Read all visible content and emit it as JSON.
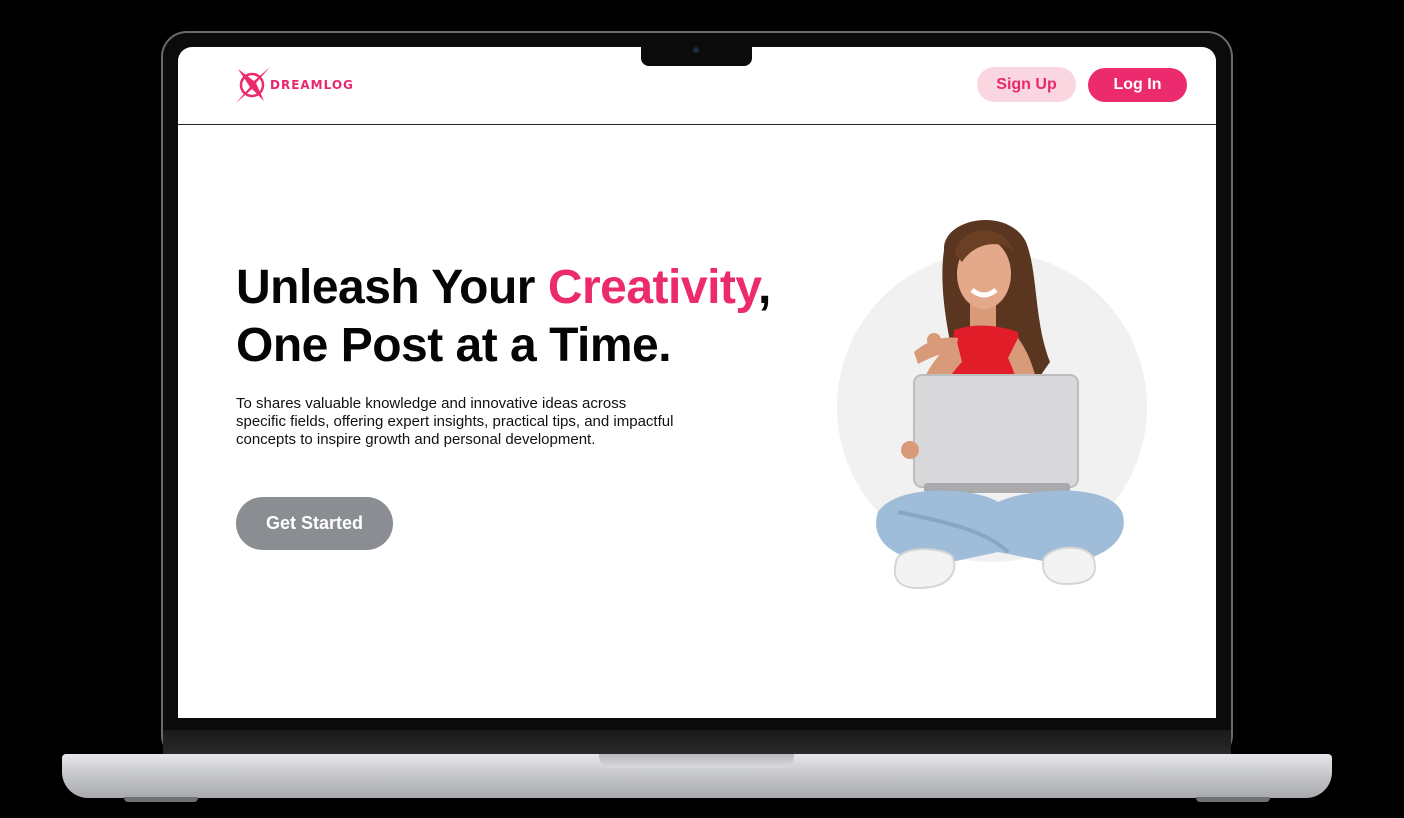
{
  "brand": {
    "name": "DREAMLOG",
    "accent_color": "#ec2a6e",
    "secondary_color": "#f9d6e0"
  },
  "nav": {
    "signup_label": "Sign Up",
    "login_label": "Log In"
  },
  "hero": {
    "headline_part1": "Unleash Your ",
    "headline_accent": "Creativity",
    "headline_part2": ",",
    "headline_line2": "One Post at a Time.",
    "description": "To shares valuable knowledge and innovative ideas across specific fields, offering expert insights, practical tips, and impactful concepts to inspire growth and personal development.",
    "cta_label": "Get Started",
    "image_icon": "woman-with-laptop-illustration"
  },
  "device": {
    "frame": "laptop-mockup",
    "camera_icon": "camera-icon"
  }
}
